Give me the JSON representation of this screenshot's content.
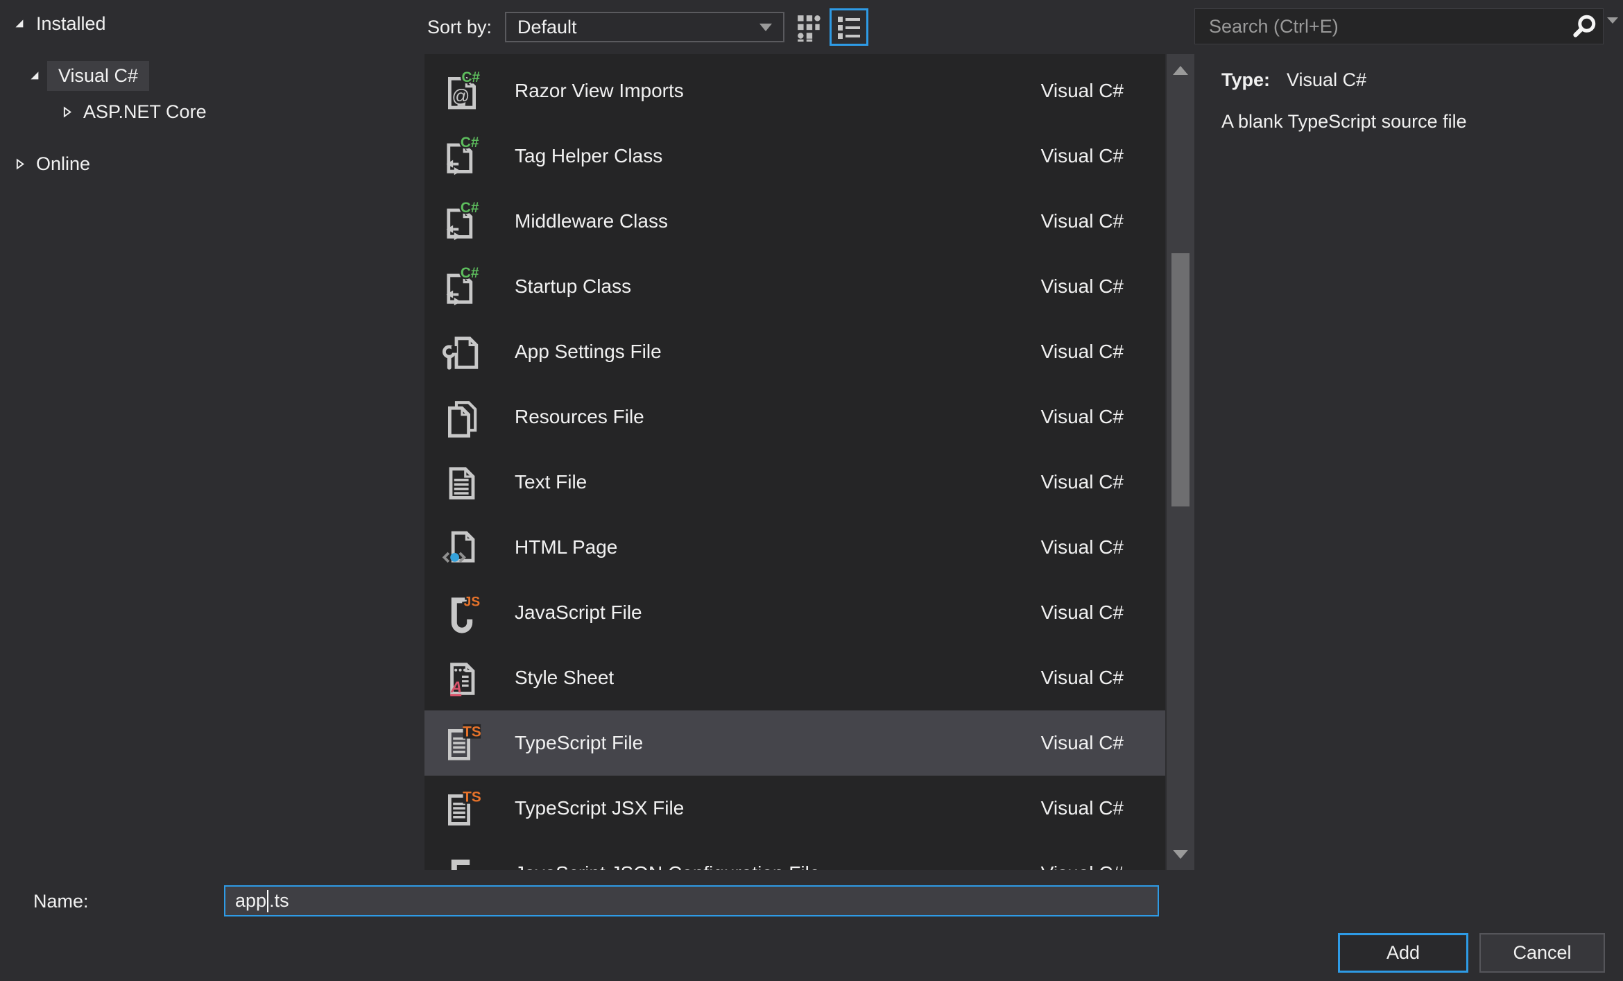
{
  "sidebar": {
    "installed_label": "Installed",
    "visual_csharp_label": "Visual C#",
    "aspnet_core_label": "ASP.NET Core",
    "online_label": "Online"
  },
  "toolbar": {
    "sort_label": "Sort by:",
    "sort_value": "Default"
  },
  "search": {
    "placeholder": "Search (Ctrl+E)"
  },
  "list": {
    "items": [
      {
        "label": "Razor View Imports",
        "lang": "Visual C#",
        "icon": "razor-view-imports",
        "selected": false
      },
      {
        "label": "Tag Helper Class",
        "lang": "Visual C#",
        "icon": "csharp-class",
        "selected": false
      },
      {
        "label": "Middleware Class",
        "lang": "Visual C#",
        "icon": "csharp-class",
        "selected": false
      },
      {
        "label": "Startup Class",
        "lang": "Visual C#",
        "icon": "csharp-class",
        "selected": false
      },
      {
        "label": "App Settings File",
        "lang": "Visual C#",
        "icon": "appsettings",
        "selected": false
      },
      {
        "label": "Resources File",
        "lang": "Visual C#",
        "icon": "resources",
        "selected": false
      },
      {
        "label": "Text File",
        "lang": "Visual C#",
        "icon": "text-file",
        "selected": false
      },
      {
        "label": "HTML Page",
        "lang": "Visual C#",
        "icon": "html-page",
        "selected": false
      },
      {
        "label": "JavaScript File",
        "lang": "Visual C#",
        "icon": "javascript-file",
        "selected": false
      },
      {
        "label": "Style Sheet",
        "lang": "Visual C#",
        "icon": "stylesheet",
        "selected": false
      },
      {
        "label": "TypeScript File",
        "lang": "Visual C#",
        "icon": "typescript-file",
        "selected": true
      },
      {
        "label": "TypeScript JSX File",
        "lang": "Visual C#",
        "icon": "typescript-file",
        "selected": false
      },
      {
        "label": "JavaScript JSON Configuration File",
        "lang": "Visual C#",
        "icon": "json-config",
        "selected": false
      }
    ]
  },
  "details": {
    "type_label": "Type:",
    "type_value": "Visual C#",
    "description": "A blank TypeScript source file"
  },
  "footer": {
    "name_label": "Name:",
    "name_value": "app.ts",
    "caret_index": 3,
    "add_label": "Add",
    "cancel_label": "Cancel"
  },
  "colors": {
    "bg": "#2D2D30",
    "panel": "#252526",
    "row-selected": "#45454B",
    "tree-selected": "#3E3E42",
    "accent": "#2E9BE6",
    "green": "#5DBD5D",
    "orange": "#E8732A",
    "blue": "#35A2DB",
    "red": "#D9536A"
  }
}
